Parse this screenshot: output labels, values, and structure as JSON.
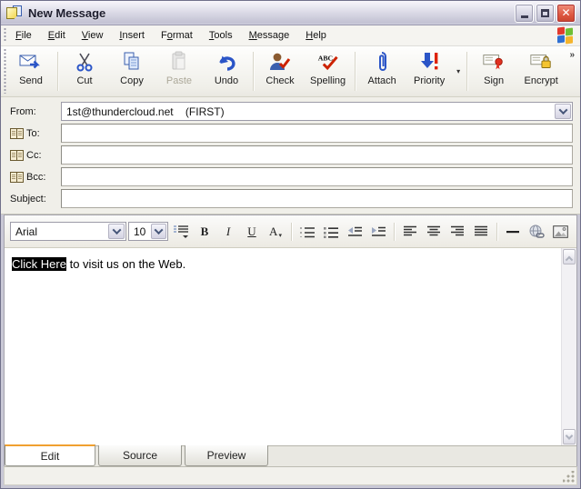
{
  "window": {
    "title": "New Message"
  },
  "titlebar": {
    "minimize": "minimize",
    "maximize": "maximize",
    "close": "close"
  },
  "menu": {
    "items": [
      {
        "label": "File",
        "m": 0
      },
      {
        "label": "Edit",
        "m": 0
      },
      {
        "label": "View",
        "m": 0
      },
      {
        "label": "Insert",
        "m": 0
      },
      {
        "label": "Format",
        "m": 1
      },
      {
        "label": "Tools",
        "m": 0
      },
      {
        "label": "Message",
        "m": 0
      },
      {
        "label": "Help",
        "m": 0
      }
    ]
  },
  "toolbar": {
    "send": "Send",
    "cut": "Cut",
    "copy": "Copy",
    "paste": "Paste",
    "undo": "Undo",
    "check": "Check",
    "spelling": "Spelling",
    "attach": "Attach",
    "priority": "Priority",
    "sign": "Sign",
    "encrypt": "Encrypt",
    "overflow": "»",
    "priority_dropdown": "▾"
  },
  "form": {
    "from": {
      "label": "From:",
      "value": "1st@thundercloud.net    (FIRST)"
    },
    "to": {
      "label": "To:",
      "value": ""
    },
    "cc": {
      "label": "Cc:",
      "value": ""
    },
    "bcc": {
      "label": "Bcc:",
      "value": ""
    },
    "subject": {
      "label": "Subject:",
      "value": ""
    }
  },
  "formatting": {
    "font_name": "Arial",
    "font_size": "10",
    "bold": "B",
    "italic": "I",
    "underline": "U",
    "font_color": "A",
    "dropdown": "▾"
  },
  "editor": {
    "selected_text": "Click Here",
    "rest_text": " to visit us on the Web."
  },
  "tabs": [
    {
      "label": "Edit"
    },
    {
      "label": "Source"
    },
    {
      "label": "Preview"
    }
  ],
  "colors": {
    "accent_orange": "#f0a030",
    "close_red": "#dd5740",
    "selection_bg": "#000000",
    "toolbar_blue": "#3a5fae",
    "check_red": "#cc2200"
  }
}
